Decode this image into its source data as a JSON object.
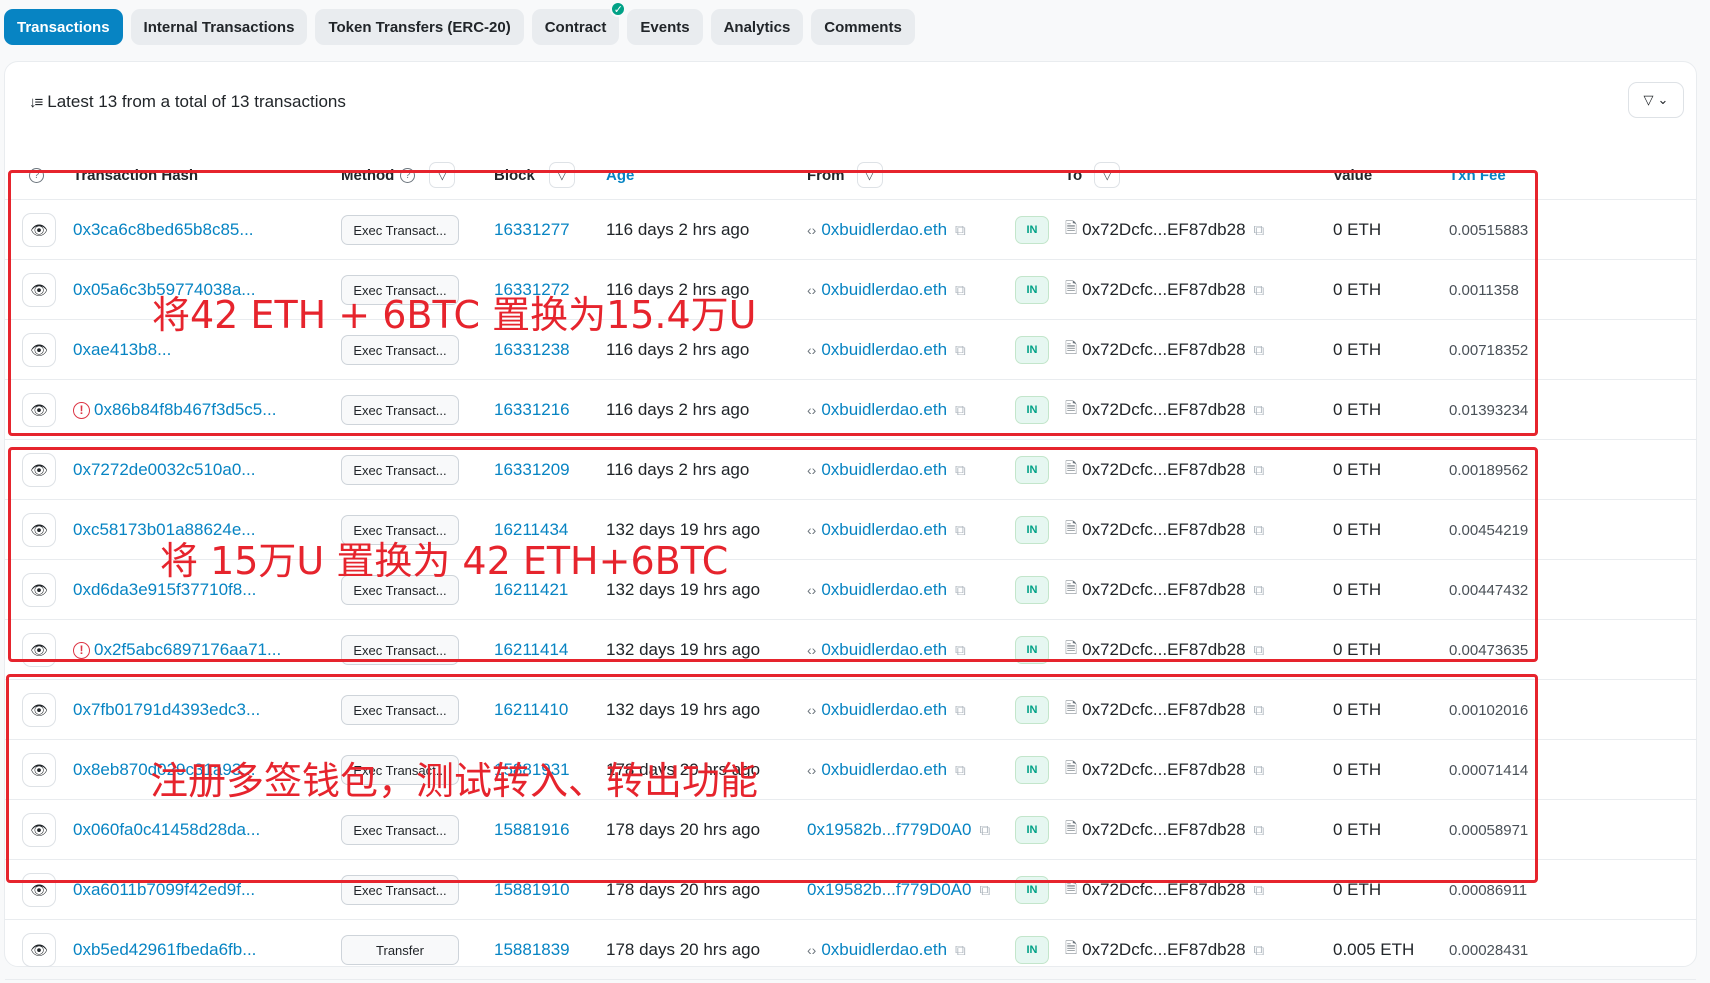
{
  "tabs": [
    {
      "label": "Transactions",
      "active": true
    },
    {
      "label": "Internal Transactions"
    },
    {
      "label": "Token Transfers (ERC-20)"
    },
    {
      "label": "Contract",
      "verified": true
    },
    {
      "label": "Events"
    },
    {
      "label": "Analytics"
    },
    {
      "label": "Comments"
    }
  ],
  "summary": "Latest 13 from a total of 13 transactions",
  "columns": {
    "hash": "Transaction Hash",
    "method": "Method",
    "block": "Block",
    "age": "Age",
    "from": "From",
    "to": "To",
    "value": "Value",
    "fee": "Txn Fee"
  },
  "rows": [
    {
      "hash": "0x3ca6c8bed65b8c85...",
      "method": "Exec Transact...",
      "block": "16331277",
      "age": "116 days 2 hrs ago",
      "from": "0xbuidlerdao.eth",
      "from_contract": true,
      "dir": "IN",
      "to": "0x72Dcfc...EF87db28",
      "value": "0 ETH",
      "fee": "0.00515883"
    },
    {
      "hash": "0x05a6c3b59774038a...",
      "method": "Exec Transact...",
      "block": "16331272",
      "age": "116 days 2 hrs ago",
      "from": "0xbuidlerdao.eth",
      "from_contract": true,
      "dir": "IN",
      "to": "0x72Dcfc...EF87db28",
      "value": "0 ETH",
      "fee": "0.0011358"
    },
    {
      "hash": "0xae413b8...",
      "method": "Exec Transact...",
      "block": "16331238",
      "age": "116 days 2 hrs ago",
      "from": "0xbuidlerdao.eth",
      "from_contract": true,
      "dir": "IN",
      "to": "0x72Dcfc...EF87db28",
      "value": "0 ETH",
      "fee": "0.00718352"
    },
    {
      "hash": "0x86b84f8b467f3d5c5...",
      "error": true,
      "method": "Exec Transact...",
      "block": "16331216",
      "age": "116 days 2 hrs ago",
      "from": "0xbuidlerdao.eth",
      "from_contract": true,
      "dir": "IN",
      "to": "0x72Dcfc...EF87db28",
      "value": "0 ETH",
      "fee": "0.01393234"
    },
    {
      "hash": "0x7272de0032c510a0...",
      "method": "Exec Transact...",
      "block": "16331209",
      "age": "116 days 2 hrs ago",
      "from": "0xbuidlerdao.eth",
      "from_contract": true,
      "dir": "IN",
      "to": "0x72Dcfc...EF87db28",
      "value": "0 ETH",
      "fee": "0.00189562"
    },
    {
      "hash": "0xc58173b01a88624e...",
      "method": "Exec Transact...",
      "block": "16211434",
      "age": "132 days 19 hrs ago",
      "from": "0xbuidlerdao.eth",
      "from_contract": true,
      "dir": "IN",
      "to": "0x72Dcfc...EF87db28",
      "value": "0 ETH",
      "fee": "0.00454219"
    },
    {
      "hash": "0xd6da3e915f37710f8...",
      "method": "Exec Transact...",
      "block": "16211421",
      "age": "132 days 19 hrs ago",
      "from": "0xbuidlerdao.eth",
      "from_contract": true,
      "dir": "IN",
      "to": "0x72Dcfc...EF87db28",
      "value": "0 ETH",
      "fee": "0.00447432"
    },
    {
      "hash": "0x2f5abc6897176aa71...",
      "error": true,
      "method": "Exec Transact...",
      "block": "16211414",
      "age": "132 days 19 hrs ago",
      "from": "0xbuidlerdao.eth",
      "from_contract": true,
      "dir": "IN",
      "to": "0x72Dcfc...EF87db28",
      "value": "0 ETH",
      "fee": "0.00473635"
    },
    {
      "hash": "0x7fb01791d4393edc3...",
      "method": "Exec Transact...",
      "block": "16211410",
      "age": "132 days 19 hrs ago",
      "from": "0xbuidlerdao.eth",
      "from_contract": true,
      "dir": "IN",
      "to": "0x72Dcfc...EF87db28",
      "value": "0 ETH",
      "fee": "0.00102016"
    },
    {
      "hash": "0x8eb870d029c31a93...",
      "method": "Exec Transact...",
      "block": "15881931",
      "age": "178 days 20 hrs ago",
      "from": "0xbuidlerdao.eth",
      "from_contract": true,
      "dir": "IN",
      "to": "0x72Dcfc...EF87db28",
      "value": "0 ETH",
      "fee": "0.00071414"
    },
    {
      "hash": "0x060fa0c41458d28da...",
      "method": "Exec Transact...",
      "block": "15881916",
      "age": "178 days 20 hrs ago",
      "from": "0x19582b...f779D0A0",
      "from_contract": false,
      "dir": "IN",
      "to": "0x72Dcfc...EF87db28",
      "value": "0 ETH",
      "fee": "0.00058971"
    },
    {
      "hash": "0xa6011b7099f42ed9f...",
      "method": "Exec Transact...",
      "block": "15881910",
      "age": "178 days 20 hrs ago",
      "from": "0x19582b...f779D0A0",
      "from_contract": false,
      "dir": "IN",
      "to": "0x72Dcfc...EF87db28",
      "value": "0 ETH",
      "fee": "0.00086911"
    },
    {
      "hash": "0xb5ed42961fbeda6fb...",
      "method": "Transfer",
      "block": "15881839",
      "age": "178 days 20 hrs ago",
      "from": "0xbuidlerdao.eth",
      "from_contract": true,
      "dir": "IN",
      "to": "0x72Dcfc...EF87db28",
      "value": "0.005 ETH",
      "fee": "0.00028431"
    }
  ],
  "annotations": [
    "将42 ETH + 6BTC 置换为15.4万U",
    "将 15万U 置换为 42 ETH+6BTC",
    "注册多签钱包，测试转入、转出功能"
  ],
  "colors": {
    "accent": "#0784c3",
    "annotation": "#e6242d",
    "in_badge": "#00a186",
    "error": "#dc3545"
  }
}
